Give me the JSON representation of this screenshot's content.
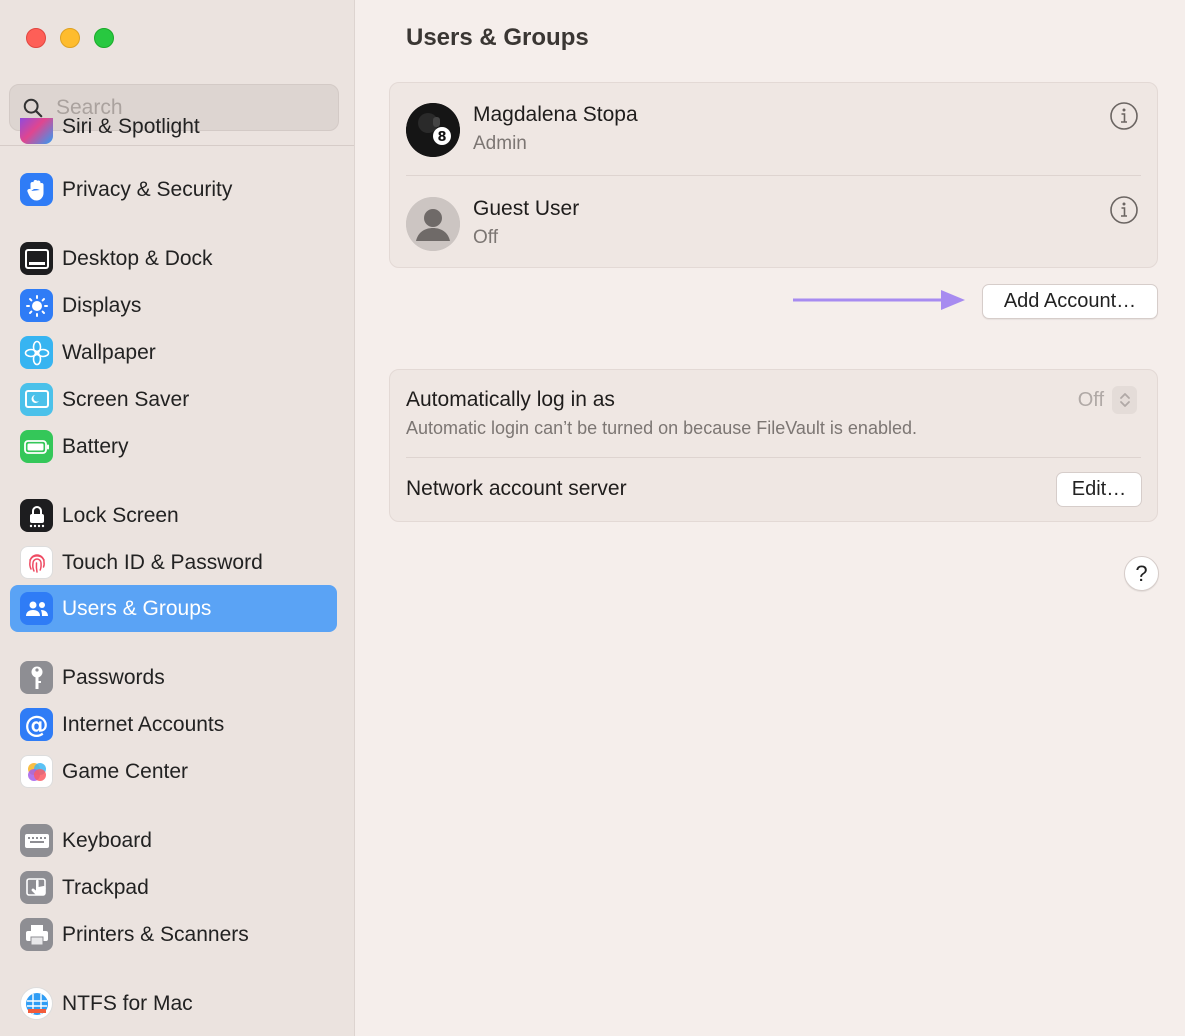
{
  "window": {
    "title": "Users & Groups",
    "traffic_lights": [
      "close",
      "minimize",
      "zoom"
    ]
  },
  "sidebar": {
    "search_placeholder": "Search",
    "cut_off_item": "Siri & Spotlight",
    "items": [
      {
        "label": "Privacy & Security",
        "icon": "hand-icon",
        "color": "#2f7cf6"
      },
      {
        "label": "Desktop & Dock",
        "icon": "dock-icon",
        "color": "#1d1d1f"
      },
      {
        "label": "Displays",
        "icon": "sun-icon",
        "color": "#2f7cf6"
      },
      {
        "label": "Wallpaper",
        "icon": "flower-icon",
        "color": "#37b4f1"
      },
      {
        "label": "Screen Saver",
        "icon": "screensaver-icon",
        "color": "#4bc1ea"
      },
      {
        "label": "Battery",
        "icon": "battery-icon",
        "color": "#34c759"
      },
      {
        "label": "Lock Screen",
        "icon": "lock-icon",
        "color": "#1d1d1f"
      },
      {
        "label": "Touch ID & Password",
        "icon": "fingerprint-icon",
        "color": "#ffffff"
      },
      {
        "label": "Users & Groups",
        "icon": "users-icon",
        "color": "#2f7cf6",
        "selected": true
      },
      {
        "label": "Passwords",
        "icon": "key-icon",
        "color": "#8e8e93"
      },
      {
        "label": "Internet Accounts",
        "icon": "at-icon",
        "color": "#2f7cf6"
      },
      {
        "label": "Game Center",
        "icon": "gamecenter-icon",
        "color": "#ffffff"
      },
      {
        "label": "Keyboard",
        "icon": "keyboard-icon",
        "color": "#8e8e93"
      },
      {
        "label": "Trackpad",
        "icon": "trackpad-icon",
        "color": "#8e8e93"
      },
      {
        "label": "Printers & Scanners",
        "icon": "printer-icon",
        "color": "#8e8e93"
      },
      {
        "label": "NTFS for Mac",
        "icon": "ntfs-icon",
        "color": "#ffffff"
      }
    ]
  },
  "users": [
    {
      "name": "Magdalena Stopa",
      "role": "Admin",
      "avatar": "eight-ball-avatar"
    },
    {
      "name": "Guest User",
      "role": "Off",
      "avatar": "silhouette-avatar"
    }
  ],
  "add_account_label": "Add Account…",
  "auto_login": {
    "title": "Automatically log in as",
    "subtitle": "Automatic login can’t be turned on because FileVault is enabled.",
    "value": "Off"
  },
  "network_server": {
    "title": "Network account server",
    "button": "Edit…"
  },
  "help_label": "?",
  "accent": "#5aa3f5",
  "arrow_color": "#a78bf0"
}
